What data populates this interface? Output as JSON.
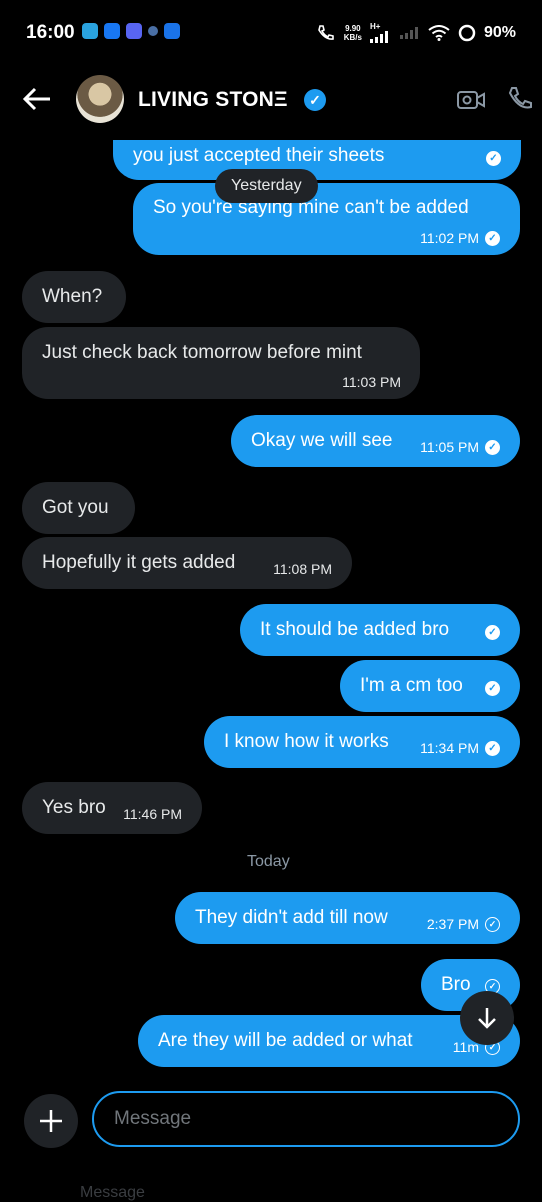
{
  "status_bar": {
    "time": "16:00",
    "speed_value": "9.90",
    "speed_unit": "KB/s",
    "network": "H+",
    "battery": "90%",
    "app_icons": [
      "telegram-icon",
      "facebook-icon",
      "discord-icon",
      "app-icon",
      "messages-icon"
    ]
  },
  "header": {
    "contact_name": "LIVING STONΞ",
    "verified": true,
    "accent": "#1d9bf0"
  },
  "dividers": {
    "yesterday": "Yesterday",
    "today": "Today"
  },
  "messages": [
    {
      "dir": "out",
      "text": "you just accepted their sheets",
      "time": "",
      "status": "read"
    },
    {
      "dir": "out",
      "text": "So you're saying mine can't be added",
      "time": "11:02 PM",
      "status": "read"
    },
    {
      "dir": "in",
      "text": "When?",
      "time": ""
    },
    {
      "dir": "in",
      "text": "Just check back tomorrow before mint",
      "time": "11:03 PM"
    },
    {
      "dir": "out",
      "text": "Okay we will see",
      "time": "11:05 PM",
      "status": "read"
    },
    {
      "dir": "in",
      "text": "Got you",
      "time": ""
    },
    {
      "dir": "in",
      "text": "Hopefully it gets added",
      "time": "11:08 PM"
    },
    {
      "dir": "out",
      "text": "It should be added bro",
      "time": "",
      "status": "read"
    },
    {
      "dir": "out",
      "text": "I'm a cm too",
      "time": "",
      "status": "read"
    },
    {
      "dir": "out",
      "text": "I know how it works",
      "time": "11:34 PM",
      "status": "read"
    },
    {
      "dir": "in",
      "text": "Yes bro",
      "time": "11:46 PM"
    },
    {
      "dir": "out",
      "text": "They didn't add till now",
      "time": "2:37 PM",
      "status": "sent"
    },
    {
      "dir": "out",
      "text": "Bro",
      "time": "",
      "status": "sent"
    },
    {
      "dir": "out",
      "text": "Are they will be added or what",
      "time": "11m",
      "status": "sent"
    }
  ],
  "composer": {
    "placeholder": "Message",
    "bottom_ghost": "Message"
  }
}
